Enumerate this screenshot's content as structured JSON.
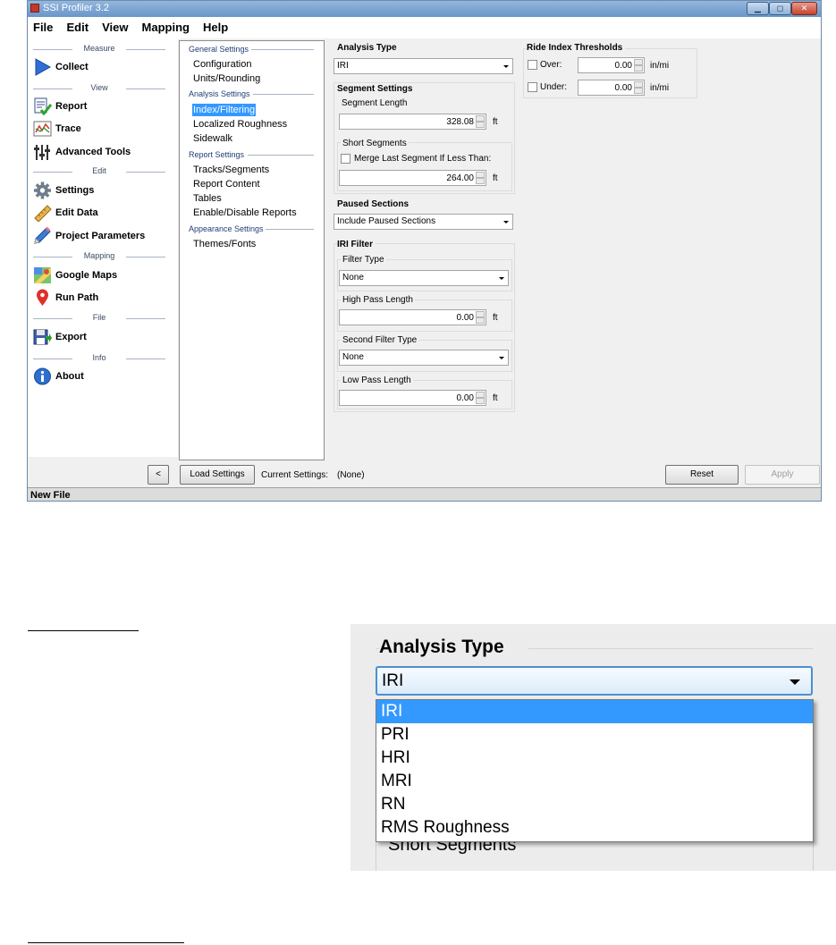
{
  "window": {
    "title": "SSI Profiler 3.2"
  },
  "menu": [
    "File",
    "Edit",
    "View",
    "Mapping",
    "Help"
  ],
  "nav": {
    "sections": [
      "Measure",
      "View",
      "Edit",
      "Mapping",
      "File",
      "Info"
    ],
    "items": [
      {
        "label": "Collect",
        "icon": "play-arrow-icon"
      },
      {
        "label": "Report",
        "icon": "report-checklist-icon"
      },
      {
        "label": "Trace",
        "icon": "trace-chart-icon"
      },
      {
        "label": "Advanced Tools",
        "icon": "sliders-icon"
      },
      {
        "label": "Settings",
        "icon": "gear-icon"
      },
      {
        "label": "Edit Data",
        "icon": "ruler-icon"
      },
      {
        "label": "Project Parameters",
        "icon": "pencil-icon"
      },
      {
        "label": "Google Maps",
        "icon": "google-maps-icon"
      },
      {
        "label": "Run Path",
        "icon": "map-pin-icon"
      },
      {
        "label": "Export",
        "icon": "floppy-export-icon"
      },
      {
        "label": "About",
        "icon": "info-icon"
      }
    ]
  },
  "tree": {
    "sections": [
      "General Settings",
      "Analysis Settings",
      "Report Settings",
      "Appearance Settings"
    ],
    "items": [
      "Configuration",
      "Units/Rounding",
      "Index/Filtering",
      "Localized Roughness",
      "Sidewalk",
      "Tracks/Segments",
      "Report Content",
      "Tables",
      "Enable/Disable Reports",
      "Themes/Fonts"
    ],
    "selected": "Index/Filtering"
  },
  "panel": {
    "analysis_type": {
      "title": "Analysis Type",
      "value": "IRI"
    },
    "segment_settings": {
      "title": "Segment Settings",
      "length_label": "Segment Length",
      "length_value": "328.08",
      "length_unit": "ft",
      "short_label": "Short Segments",
      "merge_label": "Merge Last Segment If Less Than:",
      "merge_value": "264.00",
      "merge_unit": "ft"
    },
    "paused": {
      "title": "Paused Sections",
      "value": "Include Paused Sections"
    },
    "iri_filter": {
      "title": "IRI Filter",
      "filter_type_label": "Filter Type",
      "filter_type_value": "None",
      "high_pass_label": "High Pass Length",
      "high_pass_value": "0.00",
      "high_pass_unit": "ft",
      "second_filter_label": "Second Filter Type",
      "second_filter_value": "None",
      "low_pass_label": "Low Pass Length",
      "low_pass_value": "0.00",
      "low_pass_unit": "ft"
    },
    "ride_index": {
      "title": "Ride Index Thresholds",
      "over_label": "Over:",
      "over_value": "0.00",
      "over_unit": "in/mi",
      "under_label": "Under:",
      "under_value": "0.00",
      "under_unit": "in/mi"
    }
  },
  "bottom": {
    "collapse": "<",
    "load": "Load Settings",
    "current_label": "Current Settings:",
    "current_value": "(None)",
    "reset": "Reset",
    "apply": "Apply"
  },
  "status": "New File",
  "zoom": {
    "title": "Analysis Type",
    "value": "IRI",
    "options": [
      "IRI",
      "PRI",
      "HRI",
      "MRI",
      "RN",
      "RMS Roughness"
    ],
    "highlighted": "IRI",
    "behind_label": "Short Segments"
  }
}
